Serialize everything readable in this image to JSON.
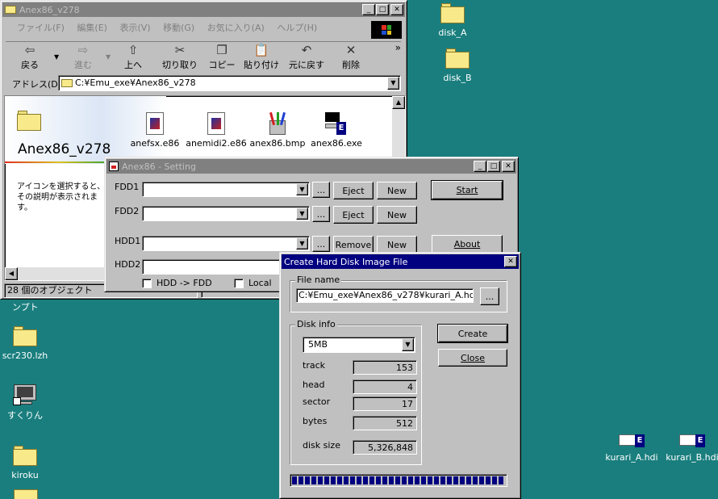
{
  "desktop": {
    "icons": [
      {
        "label": "disk_A"
      },
      {
        "label": "disk_B"
      },
      {
        "label": "ンプト"
      },
      {
        "label": "scr230.lzh"
      },
      {
        "label": "すくりん"
      },
      {
        "label": "kiroku"
      },
      {
        "label": "kurari_A.hdi"
      },
      {
        "label": "kurari_B.hdi"
      }
    ]
  },
  "explorer": {
    "title": "Anex86_v278",
    "menu": [
      "ファイル(F)",
      "編集(E)",
      "表示(V)",
      "移動(G)",
      "お気に入り(A)",
      "ヘルプ(H)"
    ],
    "toolbar": [
      "戻る",
      "進む",
      "上へ",
      "切り取り",
      "コピー",
      "貼り付け",
      "元に戻す",
      "削除"
    ],
    "more": "»",
    "address_label": "アドレス(D)",
    "address_value": "C:¥Emu_exe¥Anex86_v278",
    "folder_name": "Anex86_v278",
    "hint": "アイコンを選択すると、その説明が表示されます。",
    "files": [
      "anefsx.e86",
      "anemidi2.e86",
      "anex86.bmp",
      "anex86.exe"
    ],
    "status": "28 個のオブジェクト"
  },
  "setting": {
    "title": "Anex86 - Setting",
    "fdd1": "FDD1",
    "fdd2": "FDD2",
    "hdd1": "HDD1",
    "hdd2": "HDD2",
    "browse": "...",
    "eject": "Eject",
    "new": "New",
    "remove": "Remove",
    "start": "Start",
    "about": "About",
    "hdd_fdd": "HDD -> FDD",
    "local": "Local"
  },
  "dialog": {
    "title": "Create Hard Disk Image File",
    "file_group": "File name",
    "file_value": "C:¥Emu_exe¥Anex86_v278¥kurari_A.hdi",
    "browse": "...",
    "disk_group": "Disk info",
    "size_selected": "5MB",
    "track_label": "track",
    "track_value": "153",
    "head_label": "head",
    "head_value": "4",
    "sector_label": "sector",
    "sector_value": "17",
    "bytes_label": "bytes",
    "bytes_value": "512",
    "disksize_label": "disk size",
    "disksize_value": "5,326,848",
    "create": "Create",
    "close": "Close",
    "progress": 1.0
  }
}
